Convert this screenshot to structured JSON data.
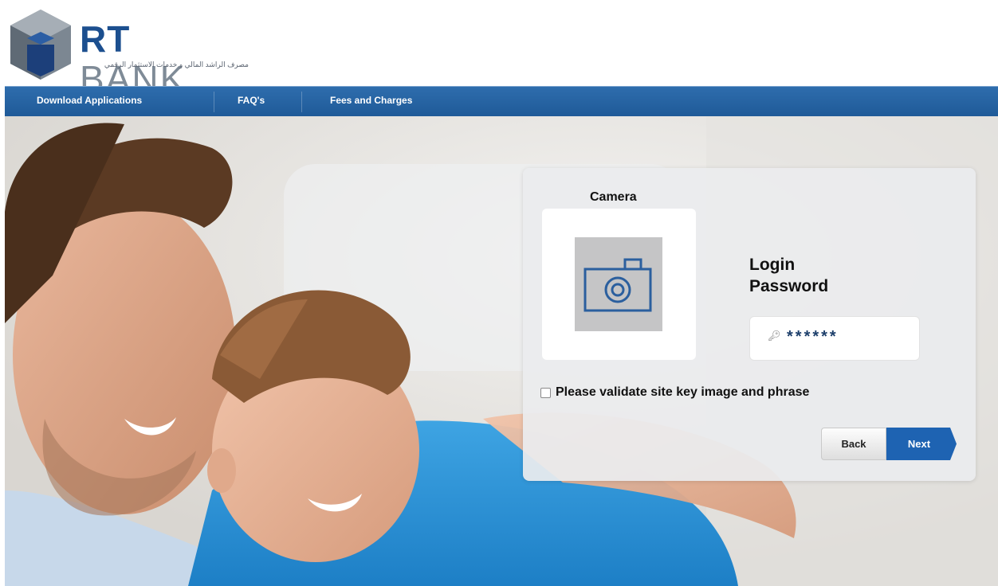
{
  "brand": {
    "name_rt": "RT",
    "name_bank": "BANK",
    "tagline": "مصرف الراشد المالي و خدمات الاستثمار الرقمي"
  },
  "nav": {
    "items": [
      {
        "label": "Download Applications"
      },
      {
        "label": "FAQ's"
      },
      {
        "label": "Fees and Charges"
      }
    ]
  },
  "login": {
    "site_key_title": "Camera",
    "site_key_icon": "camera-icon",
    "field_label_line1": "Login",
    "field_label_line2": "Password",
    "password_value": "******",
    "password_icon": "key-icon",
    "validate_label": "Please validate site key image and phrase",
    "validate_checked": false,
    "back_label": "Back",
    "next_label": "Next"
  },
  "colors": {
    "nav_blue": "#1f5a98",
    "brand_blue": "#1c4f8f",
    "next_blue": "#1e63b2"
  }
}
